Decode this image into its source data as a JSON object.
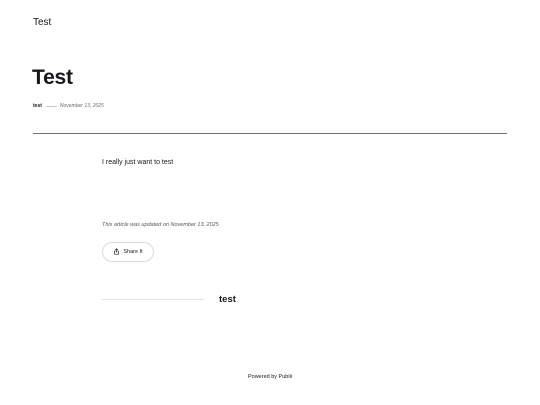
{
  "header": {
    "logo_text": "Test"
  },
  "post": {
    "title": "Test",
    "author": "test",
    "date": "November 13, 2025",
    "content": "I really just want to test",
    "updated_text": "This article was updated on November 13, 2025"
  },
  "share": {
    "label": "Share It",
    "icon": "share-icon"
  },
  "author_box": {
    "name": "test"
  },
  "footer": {
    "text": "Powered by Publii"
  }
}
